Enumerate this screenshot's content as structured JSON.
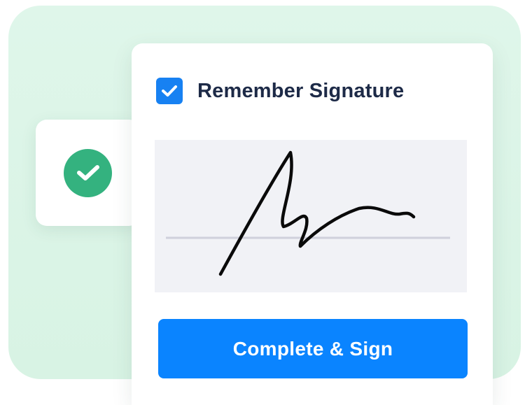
{
  "remember": {
    "label": "Remember Signature",
    "checked": true
  },
  "signature": {
    "pad_color": "#f1f2f6",
    "baseline_color": "#cfd0dc",
    "ink_color": "#0a0a0a"
  },
  "status": {
    "icon": "check-circle-icon",
    "color": "#34b27f"
  },
  "action": {
    "label": "Complete & Sign",
    "color": "#0a84ff"
  },
  "colors": {
    "background_panel": "#dff6ea",
    "checkbox": "#1781f2",
    "label_text": "#1d2a47"
  }
}
